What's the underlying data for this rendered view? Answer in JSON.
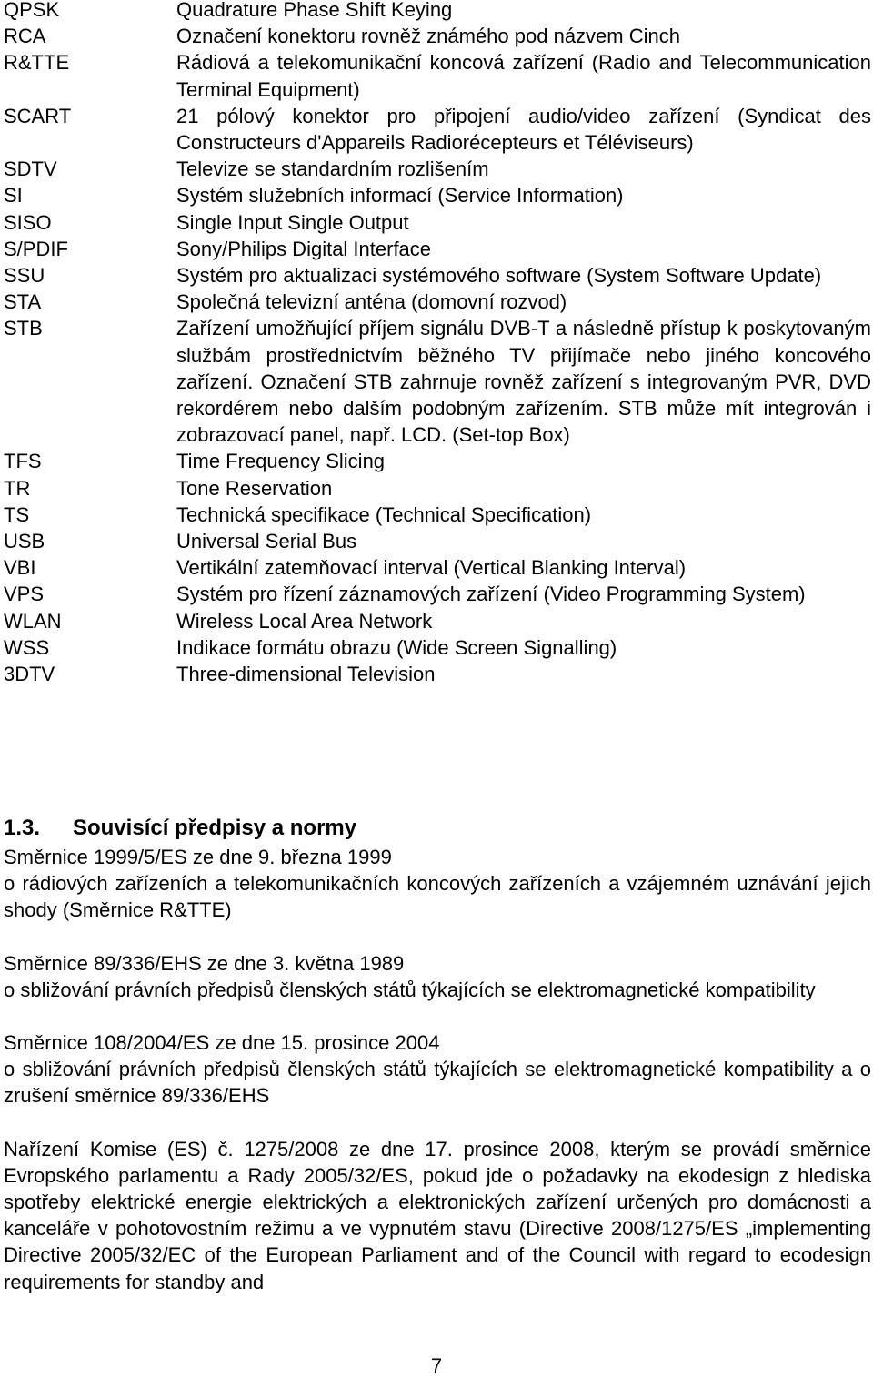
{
  "glossary": [
    {
      "abbr": "QPSK",
      "definition": "Quadrature Phase Shift Keying"
    },
    {
      "abbr": "RCA",
      "definition": "Označení konektoru rovněž známého pod názvem Cinch"
    },
    {
      "abbr": "R&TTE",
      "definition": "Rádiová a telekomunikační koncová zařízení (Radio and Telecommunication Terminal Equipment)"
    },
    {
      "abbr": "SCART",
      "definition": "21 pólový konektor pro připojení audio/video zařízení (Syndicat des Constructeurs d'Appareils Radiorécepteurs et Téléviseurs)"
    },
    {
      "abbr": "SDTV",
      "definition": "Televize se standardním rozlišením"
    },
    {
      "abbr": "SI",
      "definition": "Systém služebních informací (Service Information)"
    },
    {
      "abbr": "SISO",
      "definition": "Single Input Single Output"
    },
    {
      "abbr": "S/PDIF",
      "definition": "Sony/Philips Digital Interface"
    },
    {
      "abbr": "SSU",
      "definition": "Systém pro aktualizaci systémového software (System Software Update)"
    },
    {
      "abbr": "STA",
      "definition": "Společná televizní anténa (domovní rozvod)"
    },
    {
      "abbr": "STB",
      "definition": "Zařízení umožňující příjem signálu DVB-T a následně přístup k poskytovaným službám prostřednictvím běžného TV přijímače nebo jiného koncového zařízení. Označení STB zahrnuje rovněž zařízení s integrovaným PVR, DVD rekordérem nebo dalším podobným zařízením. STB může mít integrován i zobrazovací panel, např. LCD. (Set-top Box)"
    },
    {
      "abbr": "TFS",
      "definition": "Time Frequency Slicing"
    },
    {
      "abbr": "TR",
      "definition": "Tone Reservation"
    },
    {
      "abbr": "TS",
      "definition": "Technická specifikace (Technical Specification)"
    },
    {
      "abbr": "USB",
      "definition": "Universal Serial Bus"
    },
    {
      "abbr": "VBI",
      "definition": "Vertikální zatemňovací interval (Vertical Blanking Interval)"
    },
    {
      "abbr": "VPS",
      "definition": "Systém pro řízení záznamových zařízení (Video Programming System)"
    },
    {
      "abbr": "WLAN",
      "definition": "Wireless Local Area Network"
    },
    {
      "abbr": "WSS",
      "definition": "Indikace formátu obrazu (Wide Screen Signalling)"
    },
    {
      "abbr": "3DTV",
      "definition": "Three-dimensional Television"
    }
  ],
  "section": {
    "number": "1.3.",
    "title": "Souvisící předpisy a normy",
    "references": [
      {
        "title": "Směrnice 1999/5/ES ze dne 9. března 1999",
        "body": "o rádiových zařízeních a telekomunikačních koncových zařízeních a vzájemném uznávání jejich shody (Směrnice R&TTE)"
      },
      {
        "title": "Směrnice 89/336/EHS ze dne 3. května 1989",
        "body": "o sbližování právních předpisů členských států týkajících se elektromagnetické kompatibility"
      },
      {
        "title": "Směrnice 108/2004/ES ze dne 15. prosince 2004",
        "body": "o sbližování právních předpisů členských států týkajících se elektromagnetické kompatibility a o zrušení směrnice 89/336/EHS"
      },
      {
        "title": "",
        "body": "Nařízení Komise (ES) č. 1275/2008 ze dne 17. prosince 2008, kterým se provádí směrnice Evropského parlamentu a Rady 2005/32/ES, pokud jde o požadavky na ekodesign z hlediska spotřeby elektrické energie elektrických a elektronických zařízení určených pro domácnosti a kanceláře v pohotovostním režimu a ve vypnutém stavu (Directive 2008/1275/ES „implementing Directive 2005/32/EC of the European Parliament and of the Council with regard to ecodesign requirements for standby and"
      }
    ]
  },
  "page_number": "7"
}
